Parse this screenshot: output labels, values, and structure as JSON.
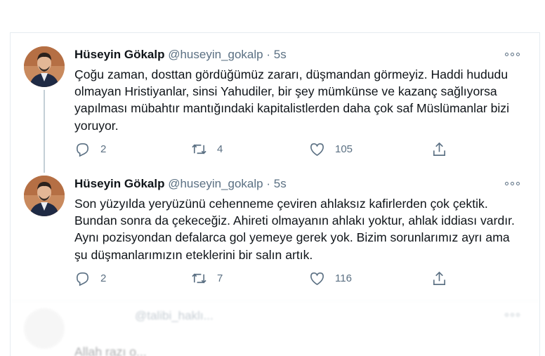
{
  "tweets": [
    {
      "name": "Hüseyin Gökalp",
      "handle": "@huseyin_gokalp",
      "dot": "·",
      "time": "5s",
      "text": "Çoğu zaman, dosttan gördüğümüz zararı, düşmandan görmeyiz. Haddi hududu olmayan Hristiyanlar, sinsi Yahudiler, bir şey mümkünse ve kazanç sağlıyorsa yapılması mübahtır mantığındaki kapitalistlerden daha çok saf Müslümanlar bizi yoruyor.",
      "replies": "2",
      "retweets": "4",
      "likes": "105"
    },
    {
      "name": "Hüseyin Gökalp",
      "handle": "@huseyin_gokalp",
      "dot": "·",
      "time": "5s",
      "text": "Son yüzyılda yeryüzünü cehenneme çeviren ahlaksız kafirlerden çok çektik. Bundan sonra da çekeceğiz. Ahireti olmayanın ahlakı yoktur, ahlak iddiası vardır. Aynı pozisyondan defalarca gol yemeye gerek yok. Bizim sorunlarımız ayrı ama şu düşmanlarımızın eteklerini bir salın artık.",
      "replies": "2",
      "retweets": "7",
      "likes": "116"
    }
  ],
  "ghost": {
    "handle": "@talibi_haklı...",
    "text": "Allah razı o..."
  },
  "icons": {
    "reply": "reply-icon",
    "retweet": "retweet-icon",
    "like": "heart-icon",
    "share": "share-icon",
    "more": "more-icon"
  },
  "colors": {
    "text": "#0f1419",
    "secondary": "#5b7083",
    "border": "#e6ecf0"
  }
}
